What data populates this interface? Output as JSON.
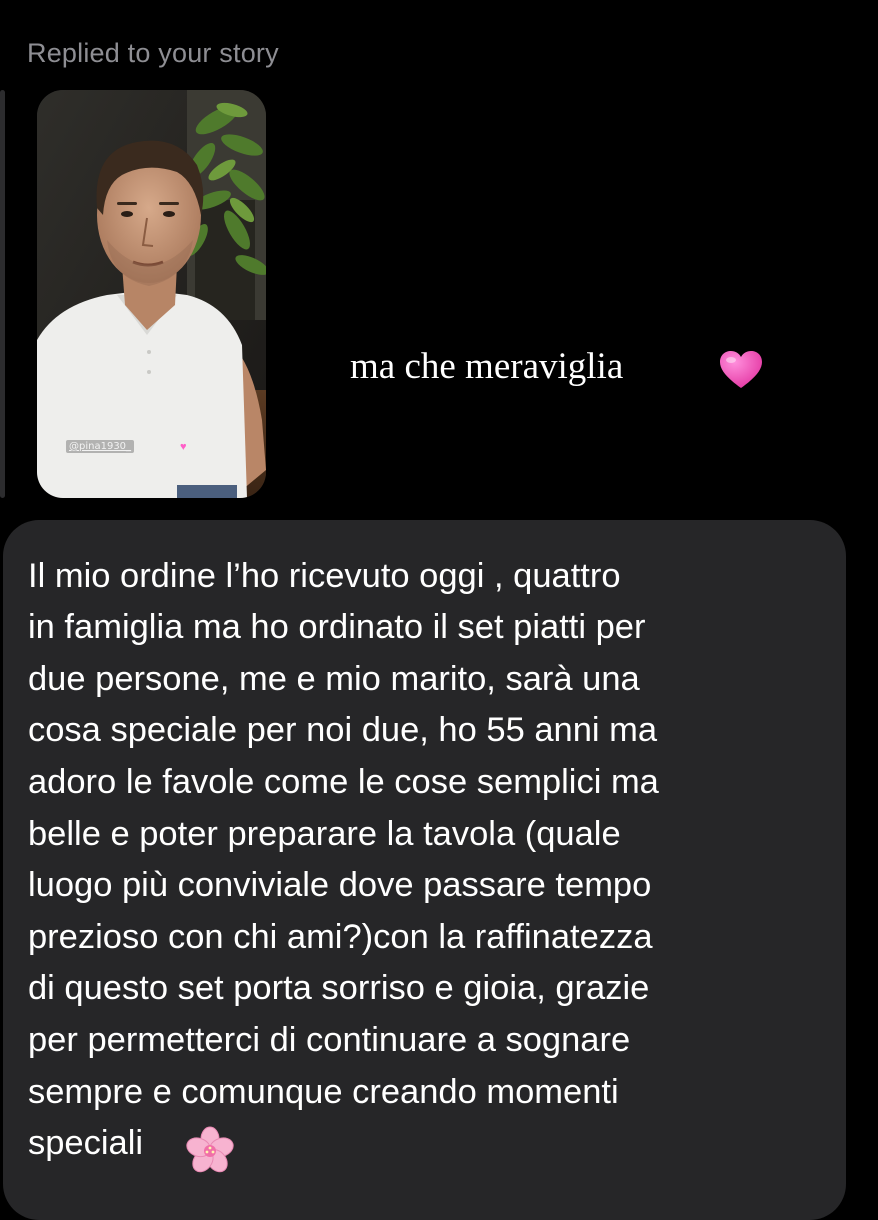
{
  "reply_context": {
    "label": "Replied to your story",
    "story_mention": "@pina1930_",
    "story_mention_icon": "pink-heart-icon"
  },
  "story_reply": {
    "text": "ma che meraviglia",
    "emoji_icon": "pink-heart-emoji-icon",
    "emoji_color": "#f25ac4"
  },
  "message": {
    "lines": [
      "Il mio ordine l’ho ricevuto oggi , quattro",
      "in famiglia ma ho ordinato il set piatti per",
      "due persone, me e mio marito, sarà una",
      "cosa speciale per noi due, ho 55 anni ma",
      "adoro le favole come le cose semplici ma",
      "belle e poter preparare la tavola (quale",
      "luogo più conviviale dove passare tempo",
      "prezioso con chi ami?)con la raffinatezza",
      "di questo set porta sorriso e gioia, grazie",
      "per permetterci di continuare a sognare",
      "sempre e comunque creando momenti",
      "speciali"
    ],
    "end_emoji_icon": "cherry-blossom-icon"
  },
  "colors": {
    "background": "#000000",
    "bubble": "#262628",
    "muted_text": "#8e8e93",
    "text": "#ffffff"
  }
}
